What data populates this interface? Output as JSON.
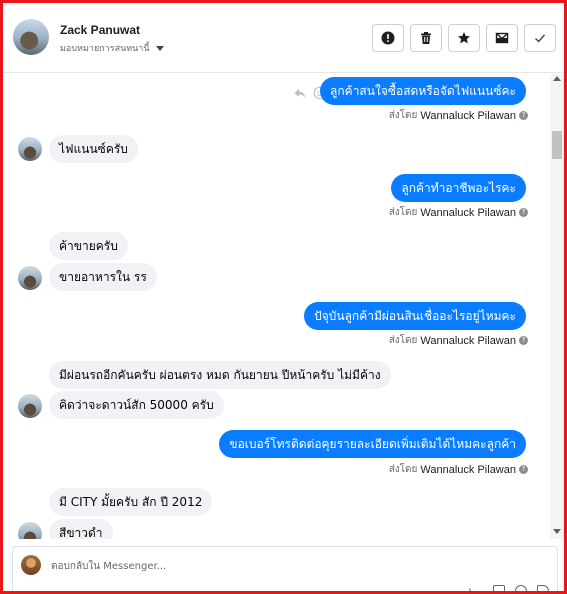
{
  "header": {
    "contact_name": "Zack Panuwat",
    "assign_label": "มอบหมายการสนทนานี้"
  },
  "actions": [
    {
      "name": "mark-spam-button",
      "icon": "exclamation-icon"
    },
    {
      "name": "delete-button",
      "icon": "trash-icon"
    },
    {
      "name": "star-button",
      "icon": "star-icon"
    },
    {
      "name": "mark-unread-button",
      "icon": "envelope-icon"
    },
    {
      "name": "mark-done-button",
      "icon": "check-icon"
    }
  ],
  "sent_by_prefix": "ส่งโดย",
  "messages": [
    {
      "dir": "out",
      "text": "ลูกค้าสนใจซื้อสดหรือจัดไฟแนนซ์คะ",
      "sender": "Wannaluck Pilawan"
    },
    {
      "dir": "in",
      "text": "ไฟแนนซ์ครับ"
    },
    {
      "dir": "out",
      "text": "ลูกค้าทำอาชีพอะไรคะ",
      "sender": "Wannaluck Pilawan"
    },
    {
      "dir": "in",
      "text": "ค้าขายครับ"
    },
    {
      "dir": "in",
      "text": "ขายอาหารใน รร"
    },
    {
      "dir": "out",
      "text": "ปัจุบันลูกค้ามีผ่อนสินเชื่ออะไรอยู่ไหมคะ",
      "sender": "Wannaluck Pilawan"
    },
    {
      "dir": "in",
      "text": "มีผ่อนรถอีกคันครับ ผ่อนตรง หมด กันยายน ปีหน้าครับ ไม่มีค้าง"
    },
    {
      "dir": "in",
      "text": "คิดว่าจะดาวน์สัก 50000 ครับ"
    },
    {
      "dir": "out",
      "text": "ขอเบอร์โทรติดต่อคุยรายละเอียดเพิ่มเติมได้ไหมคะลูกค้า",
      "sender": "Wannaluck Pilawan"
    },
    {
      "dir": "in",
      "text": "มี CITY มั้ยครับ สัก ปี 2012"
    },
    {
      "dir": "in",
      "text": "สีขาวดำ"
    }
  ],
  "composer": {
    "placeholder": "ตอบกลับใน Messenger..."
  },
  "colors": {
    "outgoing_bubble": "#0a7cff",
    "incoming_bubble": "#f0f2f5",
    "frame": "#e8161a"
  }
}
